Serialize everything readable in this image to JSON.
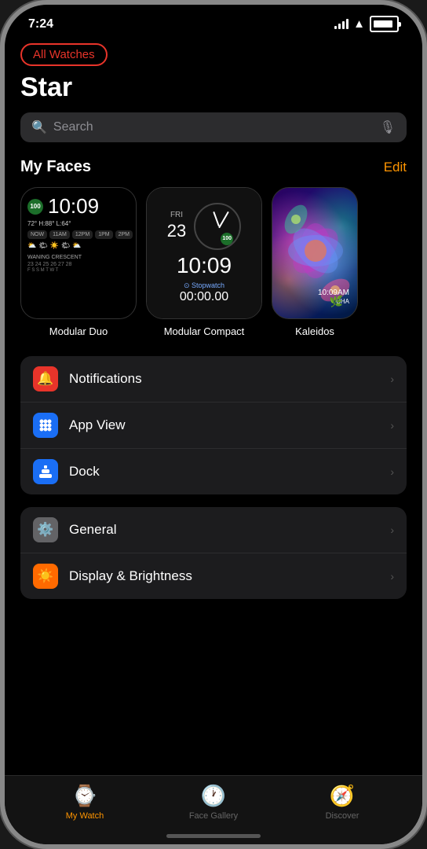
{
  "device": {
    "status_bar": {
      "time": "7:24",
      "signal": "signal",
      "wifi": "wifi",
      "battery": "battery"
    }
  },
  "nav": {
    "all_watches_label": "All Watches",
    "page_title": "Star"
  },
  "search": {
    "placeholder": "Search"
  },
  "my_faces": {
    "section_title": "My Faces",
    "edit_label": "Edit",
    "faces": [
      {
        "id": "modular-duo",
        "label": "Modular Duo"
      },
      {
        "id": "modular-compact",
        "label": "Modular Compact"
      },
      {
        "id": "kaleidoscope",
        "label": "Kaleidos"
      }
    ]
  },
  "settings_group1": {
    "items": [
      {
        "id": "notifications",
        "icon": "🔔",
        "icon_class": "icon-red",
        "label": "Notifications"
      },
      {
        "id": "app-view",
        "icon": "⚙️",
        "icon_class": "icon-blue",
        "label": "App View"
      },
      {
        "id": "dock",
        "icon": "⬜",
        "icon_class": "icon-blue2",
        "label": "Dock"
      }
    ]
  },
  "settings_group2": {
    "items": [
      {
        "id": "general",
        "icon": "⚙️",
        "icon_class": "icon-gray",
        "label": "General"
      },
      {
        "id": "display-brightness",
        "icon": "☀️",
        "icon_class": "icon-orange",
        "label": "Display & Brightness"
      }
    ]
  },
  "tab_bar": {
    "tabs": [
      {
        "id": "my-watch",
        "icon": "⌚",
        "label": "My Watch",
        "active": true
      },
      {
        "id": "face-gallery",
        "icon": "🕐",
        "label": "Face Gallery",
        "active": false
      },
      {
        "id": "discover",
        "icon": "🧭",
        "label": "Discover",
        "active": false
      }
    ]
  },
  "watch_faces": {
    "modular_duo": {
      "badge": "100",
      "time": "10:09",
      "temp": "72° H:88° L:64°",
      "moon": "WANING CRESCENT"
    },
    "modular_compact": {
      "day": "FRI",
      "date": "23",
      "time": "10:09",
      "badge": "100",
      "complication": "Stopwatch",
      "stop_time": "00:00.00"
    },
    "kaleidoscope": {
      "time": "10:09AM",
      "label": "CHA"
    }
  }
}
